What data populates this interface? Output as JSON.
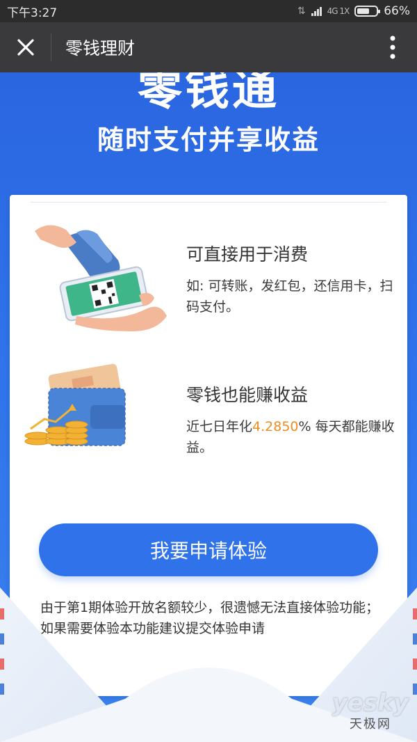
{
  "status": {
    "time": "下午3:27",
    "network": "4G 1X",
    "battery": "66%",
    "battery_level": 0.66
  },
  "nav": {
    "title": "零钱理财"
  },
  "hero": {
    "title": "零钱通",
    "subtitle": "随时支付并享收益"
  },
  "features": [
    {
      "title": "可直接用于消费",
      "desc": "如: 可转账，发红包，还信用卡，扫码支付。"
    },
    {
      "title": "零钱也能赚收益",
      "desc_prefix": "近七日年化",
      "rate": "4.2850",
      "desc_suffix": "% 每天都能赚收益。"
    }
  ],
  "apply_button": {
    "label": "我要申请体验"
  },
  "notice": "由于第1期体验开放名额较少，很遗憾无法直接体验功能；如果需要体验本功能建议提交体验申请",
  "watermark": {
    "main": "yesky",
    "sub": "天极网"
  },
  "colors": {
    "accent": "#f08c1e",
    "brand_blue": "#2f72ea"
  }
}
